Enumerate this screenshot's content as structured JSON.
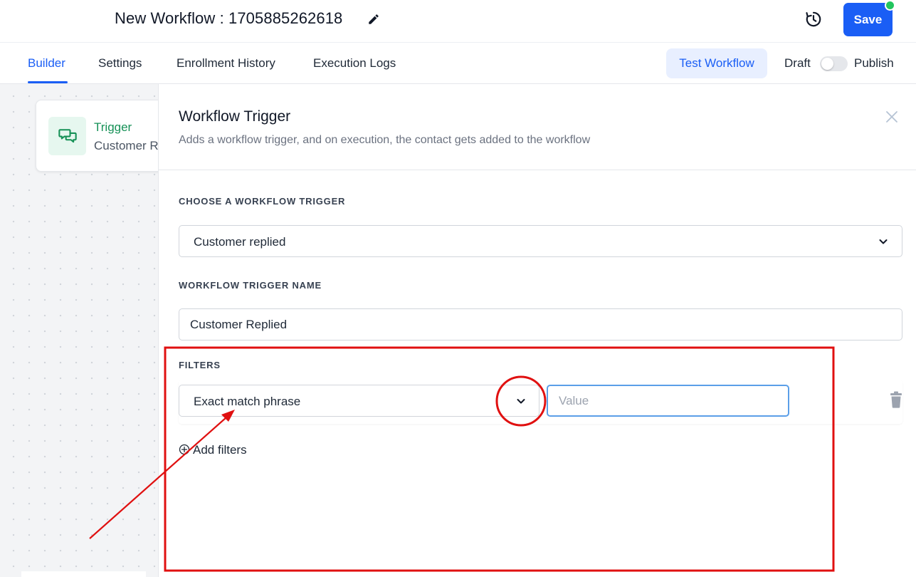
{
  "header": {
    "workflow_title": "New Workflow : 1705885262618",
    "save_label": "Save",
    "status_dot_color": "#22c55e"
  },
  "tabs": [
    {
      "label": "Builder",
      "active": true
    },
    {
      "label": "Settings",
      "active": false
    },
    {
      "label": "Enrollment History",
      "active": false
    },
    {
      "label": "Execution Logs",
      "active": false
    }
  ],
  "toolbar": {
    "test_workflow_label": "Test Workflow",
    "draft_label": "Draft",
    "publish_label": "Publish",
    "published": false
  },
  "canvas": {
    "trigger_card": {
      "title": "Trigger",
      "subtitle": "Customer Replied",
      "icon": "chat-bubbles-icon"
    }
  },
  "panel": {
    "title": "Workflow Trigger",
    "subtitle": "Adds a workflow trigger, and on execution, the contact gets added to the workflow",
    "choose_trigger_label": "CHOOSE A WORKFLOW TRIGGER",
    "selected_trigger": "Customer replied",
    "trigger_name_label": "WORKFLOW TRIGGER NAME",
    "trigger_name_value": "Customer Replied",
    "filters_label": "FILTERS",
    "filter": {
      "type": "Exact match phrase",
      "value": "",
      "value_placeholder": "Value"
    },
    "add_filters_label": "Add filters"
  },
  "theme": {
    "accent": "#1a5ef5",
    "trigger_green": "#169157",
    "annotation_red": "#e01010"
  }
}
